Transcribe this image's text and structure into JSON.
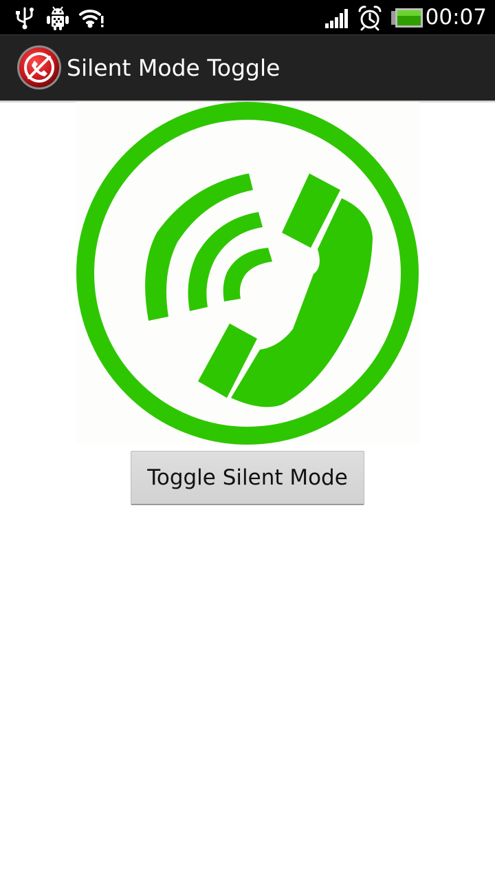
{
  "status_bar": {
    "icons_left": [
      "usb-icon",
      "android-debug-icon",
      "wifi-icon"
    ],
    "icons_right": [
      "signal-icon",
      "alarm-icon",
      "battery-icon"
    ],
    "time": "00:07"
  },
  "app_bar": {
    "icon": "silent-phone-icon",
    "title": "Silent Mode Toggle"
  },
  "main": {
    "image": "phone-ringing-icon",
    "toggle_button_label": "Toggle Silent Mode"
  },
  "colors": {
    "status_bar_bg": "#000000",
    "action_bar_bg": "#222222",
    "phone_green": "#2ec600",
    "button_bg": "#d6d6d6",
    "app_icon_red": "#c4161c"
  }
}
